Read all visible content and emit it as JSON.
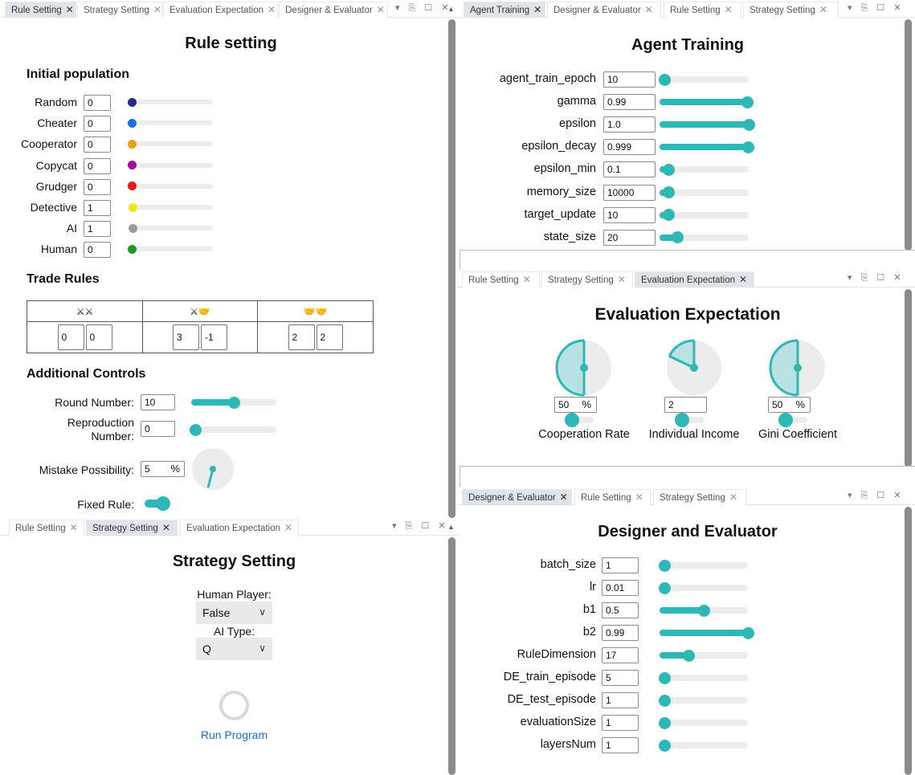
{
  "colors": {
    "teal": "#2db7b7",
    "track": "#ececec",
    "tab_active_bg": "#dfe4ea",
    "link": "#1a6fc9"
  },
  "window_controls": "▾ ⎘ ☐ ✕",
  "rule_panel": {
    "tabs": [
      {
        "label": "Rule Setting",
        "active": true
      },
      {
        "label": "Strategy Setting",
        "active": false
      },
      {
        "label": "Evaluation Expectation",
        "active": false
      },
      {
        "label": "Designer & Evaluator",
        "active": false
      }
    ],
    "title": "Rule setting",
    "initial_population": {
      "heading": "Initial population",
      "rows": [
        {
          "label": "Random",
          "value": "0",
          "color": "#2a2a8a",
          "fraction": 0
        },
        {
          "label": "Cheater",
          "value": "0",
          "color": "#1a6ee8",
          "fraction": 0
        },
        {
          "label": "Cooperator",
          "value": "0",
          "color": "#f39c12",
          "fraction": 0
        },
        {
          "label": "Copycat",
          "value": "0",
          "color": "#9b0ea0",
          "fraction": 0
        },
        {
          "label": "Grudger",
          "value": "0",
          "color": "#e81818",
          "fraction": 0
        },
        {
          "label": "Detective",
          "value": "1",
          "color": "#f5e61a",
          "fraction": 0.02
        },
        {
          "label": "AI",
          "value": "1",
          "color": "#9a9a9a",
          "fraction": 0.02
        },
        {
          "label": "Human",
          "value": "0",
          "color": "#1a9a2a",
          "fraction": 0
        }
      ]
    },
    "trade_rules": {
      "heading": "Trade Rules",
      "headers": [
        "⚔⚔",
        "⚔🤝",
        "🤝🤝"
      ],
      "values": [
        [
          "0",
          "0"
        ],
        [
          "3",
          "-1"
        ],
        [
          "2",
          "2"
        ]
      ]
    },
    "additional": {
      "heading": "Additional Controls",
      "round_label": "Round Number:",
      "round_value": "10",
      "round_fraction": 0.5,
      "repro_label_1": "Reproduction",
      "repro_label_2": "Number:",
      "repro_value": "0",
      "repro_fraction": 0.05,
      "mistake_label": "Mistake Possibility:",
      "mistake_value": "5",
      "mistake_unit": "%",
      "fixed_label": "Fixed Rule:",
      "fixed_on": true
    }
  },
  "strategy_panel": {
    "tabs": [
      {
        "label": "Rule Setting",
        "active": false
      },
      {
        "label": "Strategy Setting",
        "active": true
      },
      {
        "label": "Evaluation Expectation",
        "active": false
      }
    ],
    "title": "Strategy Setting",
    "human_label": "Human Player:",
    "human_value": "False",
    "ai_label": "AI Type:",
    "ai_value": "Q",
    "run_label": "Run Program"
  },
  "agent_panel": {
    "tabs": [
      {
        "label": "Agent Training",
        "active": true
      },
      {
        "label": "Designer & Evaluator",
        "active": false
      },
      {
        "label": "Rule Setting",
        "active": false
      },
      {
        "label": "Strategy Setting",
        "active": false
      }
    ],
    "title": "Agent Training",
    "params": [
      {
        "label": "agent_train_epoch",
        "value": "10",
        "fraction": 0.02
      },
      {
        "label": "gamma",
        "value": "0.99",
        "fraction": 0.99
      },
      {
        "label": "epsilon",
        "value": "1.0",
        "fraction": 1.0
      },
      {
        "label": "epsilon_decay",
        "value": "0.999",
        "fraction": 0.999
      },
      {
        "label": "epsilon_min",
        "value": "0.1",
        "fraction": 0.1
      },
      {
        "label": "memory_size",
        "value": "10000",
        "fraction": 0.1
      },
      {
        "label": "target_update",
        "value": "10",
        "fraction": 0.1
      },
      {
        "label": "state_size",
        "value": "20",
        "fraction": 0.2
      }
    ]
  },
  "eval_panel": {
    "tabs": [
      {
        "label": "Rule Setting",
        "active": false
      },
      {
        "label": "Strategy Setting",
        "active": false
      },
      {
        "label": "Evaluation Expectation",
        "active": true
      }
    ],
    "title": "Evaluation Expectation",
    "metrics": [
      {
        "label": "Cooperation Rate",
        "value": "50",
        "unit": "%",
        "fraction": 0.5
      },
      {
        "label": "Individual Income",
        "value": "2",
        "unit": "",
        "fraction": 0.18
      },
      {
        "label": "Gini Coefficient",
        "value": "50",
        "unit": "%",
        "fraction": 0.5
      }
    ]
  },
  "designer_panel": {
    "tabs": [
      {
        "label": "Designer & Evaluator",
        "active": true
      },
      {
        "label": "Rule Setting",
        "active": false
      },
      {
        "label": "Strategy Setting",
        "active": false
      }
    ],
    "title": "Designer and Evaluator",
    "params": [
      {
        "label": "batch_size",
        "value": "1",
        "fraction": 0
      },
      {
        "label": "lr",
        "value": "0.01",
        "fraction": 0
      },
      {
        "label": "b1",
        "value": "0.5",
        "fraction": 0.5
      },
      {
        "label": "b2",
        "value": "0.99",
        "fraction": 1.0
      },
      {
        "label": "RuleDimension",
        "value": "17",
        "fraction": 0.33
      },
      {
        "label": "DE_train_episode",
        "value": "5",
        "fraction": 0.06
      },
      {
        "label": "DE_test_episode",
        "value": "1",
        "fraction": 0
      },
      {
        "label": "evaluationSize",
        "value": "1",
        "fraction": 0
      },
      {
        "label": "layersNum",
        "value": "1",
        "fraction": 0
      }
    ]
  }
}
